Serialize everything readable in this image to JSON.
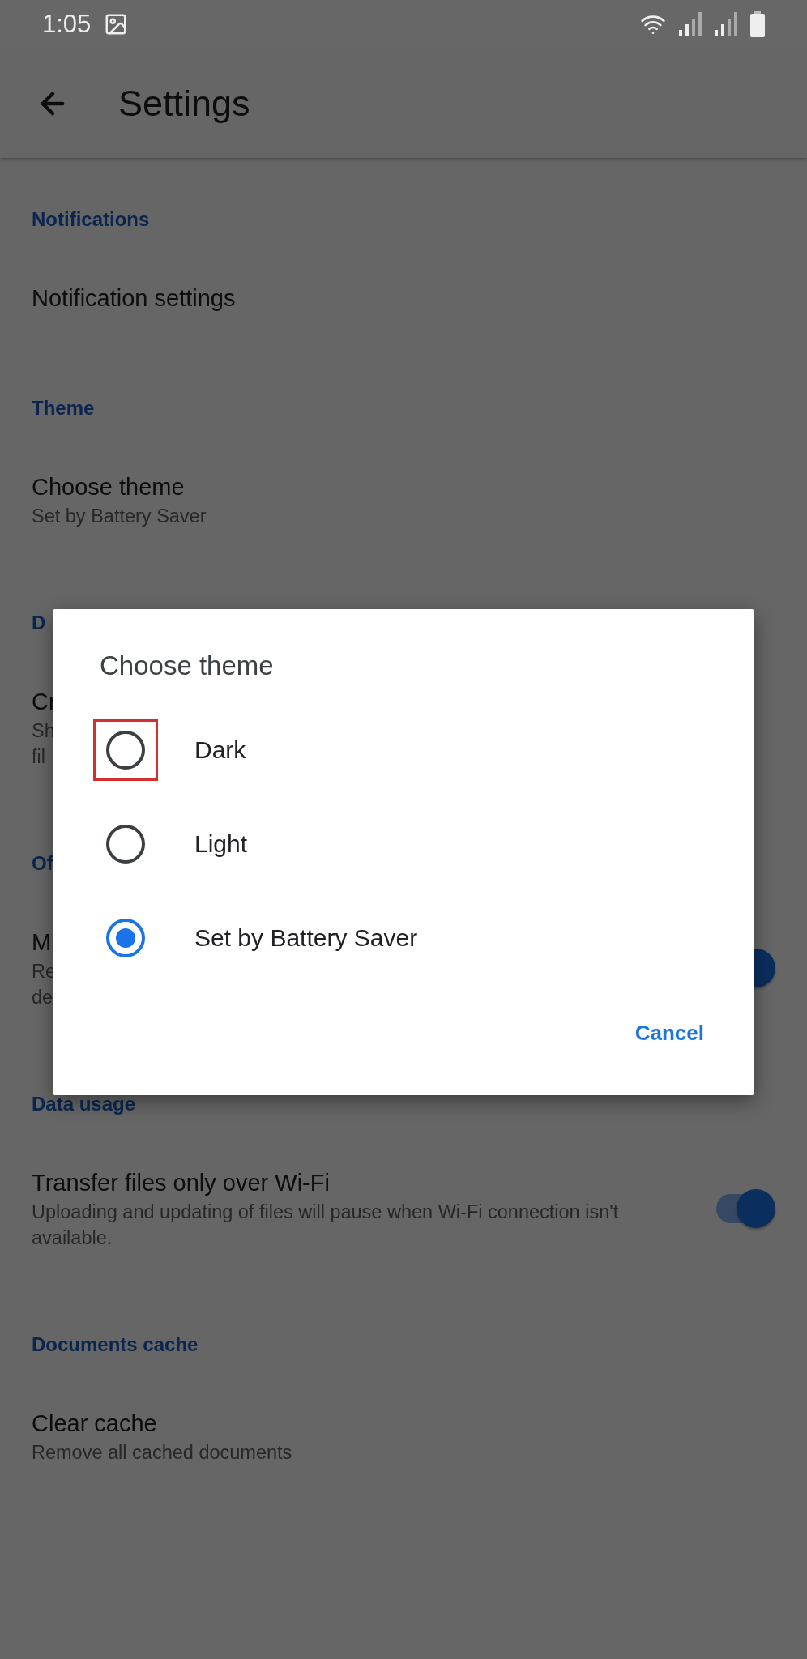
{
  "status_bar": {
    "time": "1:05"
  },
  "app_bar": {
    "title": "Settings"
  },
  "sections": [
    {
      "header": "Notifications",
      "items": [
        {
          "title": "Notification settings"
        }
      ]
    },
    {
      "header": "Theme",
      "items": [
        {
          "title": "Choose theme",
          "subtitle_lines": [
            "Set by Battery Saver"
          ]
        }
      ]
    },
    {
      "header": "D",
      "items": [
        {
          "title": "Cr",
          "subtitle_lines": [
            "Sh",
            "fil"
          ]
        }
      ]
    },
    {
      "header": "Of",
      "items": [
        {
          "title": "M",
          "subtitle_lines": [
            "Re",
            "de"
          ],
          "toggle": {
            "on": true
          }
        }
      ]
    },
    {
      "header": "Data usage",
      "items": [
        {
          "title": "Transfer files only over Wi-Fi",
          "subtitle_lines": [
            "Uploading and updating of files will pause when Wi-Fi connection isn't available."
          ],
          "toggle": {
            "on": true
          }
        }
      ]
    },
    {
      "header": "Documents cache",
      "items": [
        {
          "title": "Clear cache",
          "subtitle_lines": [
            "Remove all cached documents"
          ]
        }
      ]
    }
  ],
  "dialog": {
    "title": "Choose theme",
    "options": [
      {
        "label": "Dark",
        "selected": false,
        "highlighted": true
      },
      {
        "label": "Light",
        "selected": false,
        "highlighted": false
      },
      {
        "label": "Set by Battery Saver",
        "selected": true,
        "highlighted": false
      }
    ],
    "buttons": [
      "Cancel"
    ]
  }
}
